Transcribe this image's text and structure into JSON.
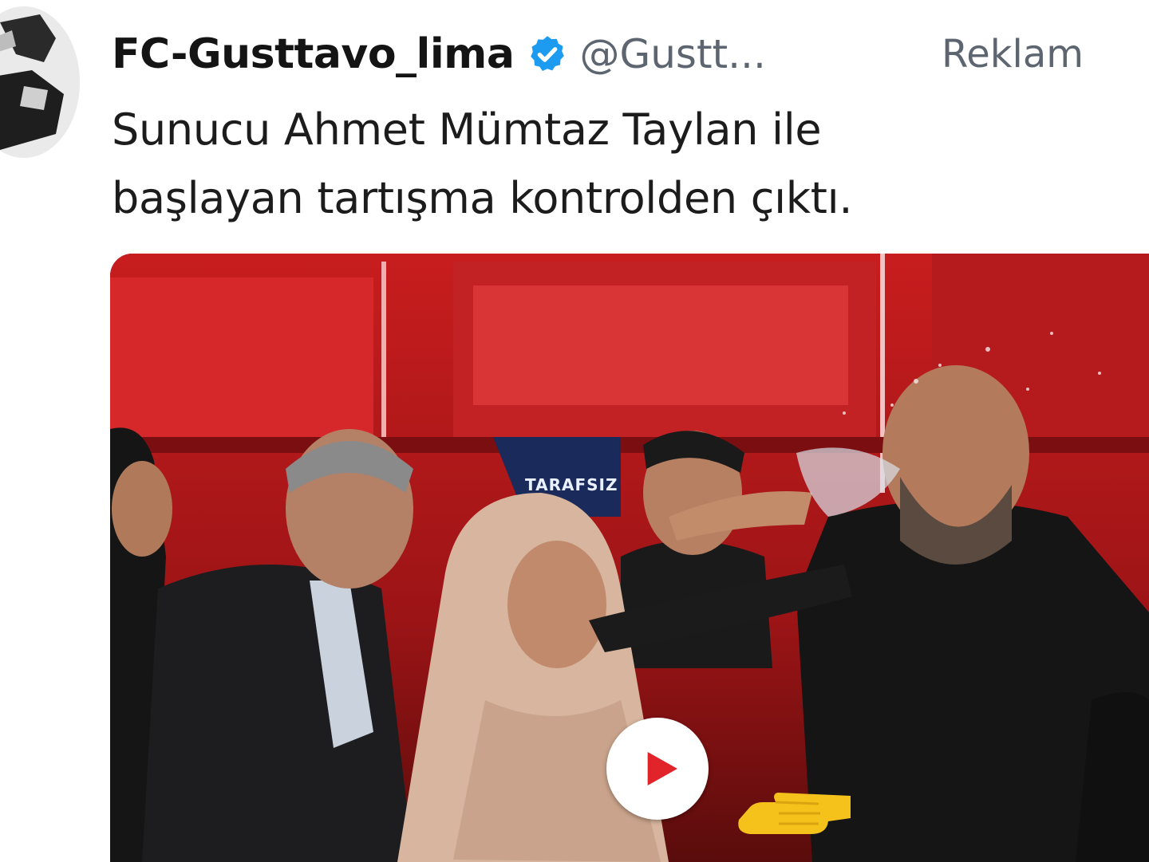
{
  "tweet": {
    "author": {
      "display_name": "FC-Gusttavo_lima",
      "handle": "@Gustt...",
      "avatar_icon": "avatar-image",
      "verified_icon": "verified-badge-icon",
      "verified_color": "#1d9bf0"
    },
    "ad_label": "Reklam",
    "text_lines": [
      "Sunucu Ahmet Mümtaz Taylan ile",
      "başlayan tartışma kontrolden çıktı."
    ],
    "media": {
      "type": "video",
      "overlay_text": "TARAFSIZ",
      "play_icon": "play-icon",
      "play_color": "#e0242a",
      "hand_icon": "pointing-hand-icon",
      "background_color": "#b3191b"
    }
  }
}
